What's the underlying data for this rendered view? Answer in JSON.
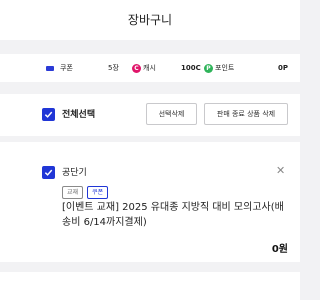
{
  "header": {
    "title": "장바구니"
  },
  "points": {
    "coupon_icon": "ticket-icon",
    "coupon_label": "쿠폰",
    "coupon_count": "5장",
    "cash_icon_glyph": "C",
    "cash_label": "캐시",
    "cash_amount": "100C",
    "point_icon_glyph": "P",
    "point_label": "포인트",
    "point_amount": "0P",
    "colors": {
      "coupon": "#2b3bd6",
      "cash": "#e0156a",
      "point": "#2fb45a"
    }
  },
  "select_all": {
    "label": "전체선택",
    "checked": true,
    "delete_selected": "선택삭제",
    "delete_ended": "판매 종료 상품 삭제"
  },
  "cart_item": {
    "checked": true,
    "seller": "공단기",
    "close_glyph": "✕",
    "tags": [
      "교재",
      "쿠폰"
    ],
    "name": "[이벤트 교재] 2025 유대종 지방직 대비 모의고사(배송비 6/14까지결제)",
    "price": "0원"
  },
  "accent_color": "#2036d6"
}
